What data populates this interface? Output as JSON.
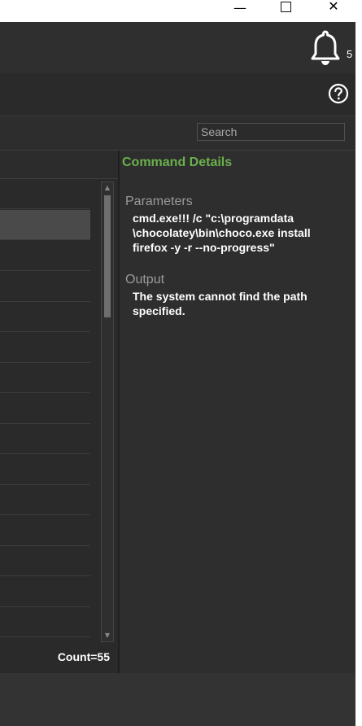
{
  "window": {
    "minimize_glyph": "—",
    "close_glyph": "✕"
  },
  "header": {
    "notification_count": "5",
    "bell_icon": "bell-icon"
  },
  "toolbar": {
    "help_icon": "help-circle-icon"
  },
  "search": {
    "placeholder": "Search"
  },
  "list": {
    "count_label": "Count=55",
    "selected_row_index": 0
  },
  "details": {
    "title": "Command Details",
    "parameters_label": "Parameters",
    "parameters_text": "cmd.exe!!! /c \"c:\\programdata\n\\chocolatey\\bin\\choco.exe install\nfirefox -y -r --no-progress\"",
    "output_label": "Output",
    "output_text": "The system cannot find the path\nspecified."
  },
  "colors": {
    "accent_green": "#6ab04c"
  }
}
